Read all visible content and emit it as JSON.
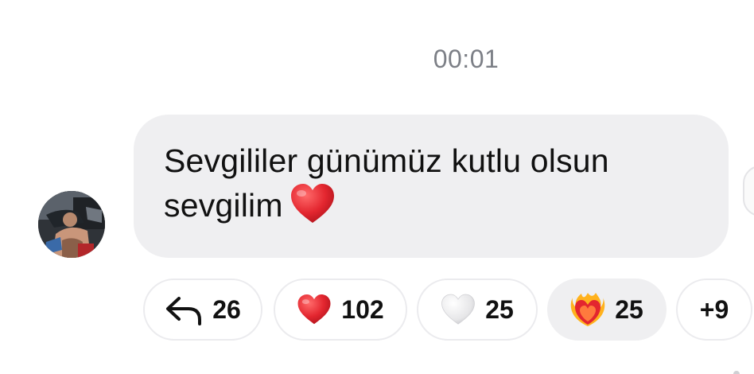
{
  "timestamp": "00:01",
  "message": {
    "text": "Sevgililer günümüz kutlu olsun sevgilim",
    "emoji": "red-heart-icon"
  },
  "reactions": [
    {
      "icon": "reply-arrow-icon",
      "count": "26"
    },
    {
      "icon": "red-heart-icon",
      "count": "102"
    },
    {
      "icon": "white-heart-icon",
      "count": "25"
    },
    {
      "icon": "heart-on-fire-icon",
      "count": "25"
    },
    {
      "icon": "",
      "count": "+9"
    }
  ],
  "colors": {
    "bubble_bg": "#efeff1",
    "timestamp": "#7c7f86",
    "heart": "#e3262f",
    "pill_border": "#ebebee"
  }
}
